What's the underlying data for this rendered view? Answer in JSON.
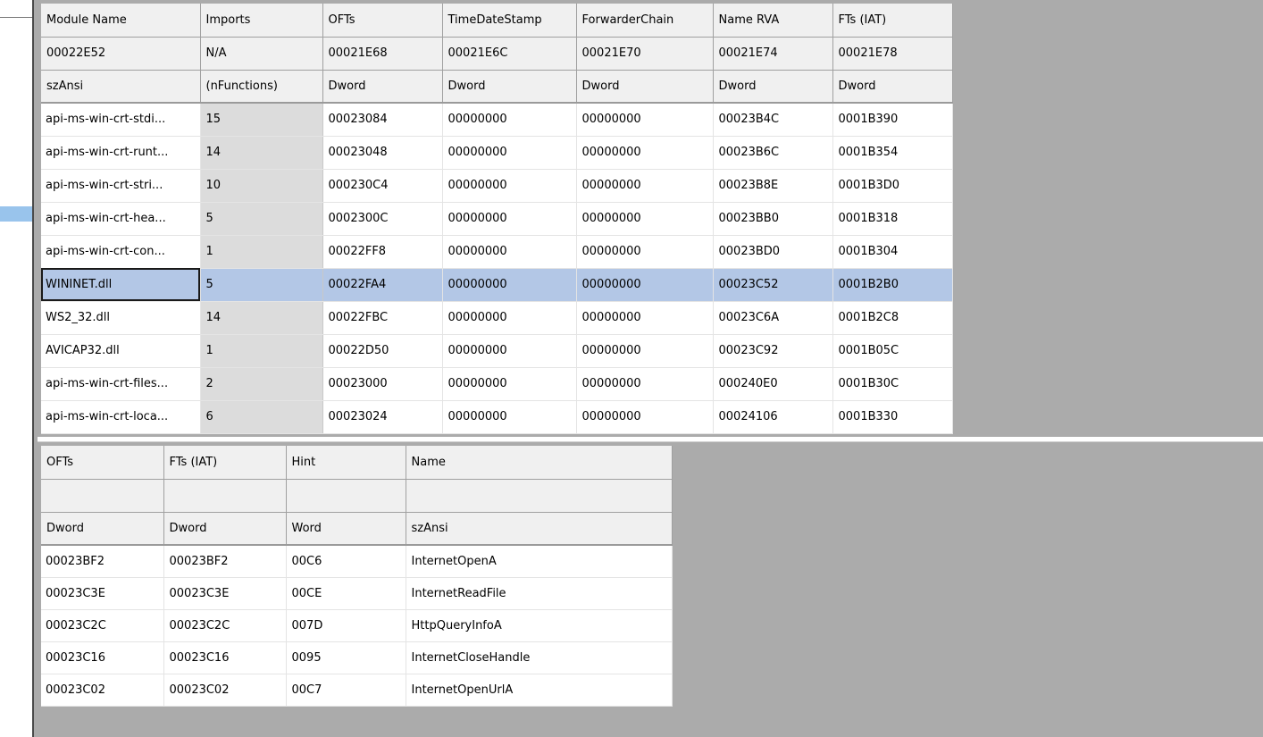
{
  "modules_table": {
    "header_rows": [
      [
        "Module Name",
        "Imports",
        "OFTs",
        "TimeDateStamp",
        "ForwarderChain",
        "Name RVA",
        "FTs (IAT)"
      ],
      [
        "00022E52",
        "N/A",
        "00021E68",
        "00021E6C",
        "00021E70",
        "00021E74",
        "00021E78"
      ],
      [
        "szAnsi",
        "(nFunctions)",
        "Dword",
        "Dword",
        "Dword",
        "Dword",
        "Dword"
      ]
    ],
    "rows": [
      [
        "api-ms-win-crt-stdi...",
        "15",
        "00023084",
        "00000000",
        "00000000",
        "00023B4C",
        "0001B390"
      ],
      [
        "api-ms-win-crt-runt...",
        "14",
        "00023048",
        "00000000",
        "00000000",
        "00023B6C",
        "0001B354"
      ],
      [
        "api-ms-win-crt-stri...",
        "10",
        "000230C4",
        "00000000",
        "00000000",
        "00023B8E",
        "0001B3D0"
      ],
      [
        "api-ms-win-crt-hea...",
        "5",
        "0002300C",
        "00000000",
        "00000000",
        "00023BB0",
        "0001B318"
      ],
      [
        "api-ms-win-crt-con...",
        "1",
        "00022FF8",
        "00000000",
        "00000000",
        "00023BD0",
        "0001B304"
      ],
      [
        "WININET.dll",
        "5",
        "00022FA4",
        "00000000",
        "00000000",
        "00023C52",
        "0001B2B0"
      ],
      [
        "WS2_32.dll",
        "14",
        "00022FBC",
        "00000000",
        "00000000",
        "00023C6A",
        "0001B2C8"
      ],
      [
        "AVICAP32.dll",
        "1",
        "00022D50",
        "00000000",
        "00000000",
        "00023C92",
        "0001B05C"
      ],
      [
        "api-ms-win-crt-files...",
        "2",
        "00023000",
        "00000000",
        "00000000",
        "000240E0",
        "0001B30C"
      ],
      [
        "api-ms-win-crt-loca...",
        "6",
        "00023024",
        "00000000",
        "00000000",
        "00024106",
        "0001B330"
      ]
    ],
    "selected_row": 5
  },
  "functions_table": {
    "header_rows": [
      [
        "OFTs",
        "FTs (IAT)",
        "Hint",
        "Name"
      ],
      [
        "",
        "",
        "",
        ""
      ],
      [
        "Dword",
        "Dword",
        "Word",
        "szAnsi"
      ]
    ],
    "rows": [
      [
        "00023BF2",
        "00023BF2",
        "00C6",
        "InternetOpenA"
      ],
      [
        "00023C3E",
        "00023C3E",
        "00CE",
        "InternetReadFile"
      ],
      [
        "00023C2C",
        "00023C2C",
        "007D",
        "HttpQueryInfoA"
      ],
      [
        "00023C16",
        "00023C16",
        "0095",
        "InternetCloseHandle"
      ],
      [
        "00023C02",
        "00023C02",
        "00C7",
        "InternetOpenUrlA"
      ]
    ]
  },
  "colors": {
    "selection": "#b3c7e6",
    "header_bg": "#f0f0f0",
    "imports_col_bg": "#dcdcdc",
    "pane_bg": "#ababab"
  }
}
